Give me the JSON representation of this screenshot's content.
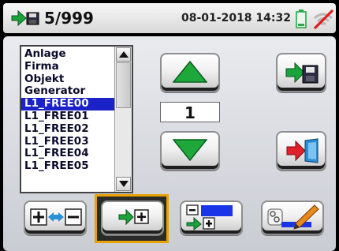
{
  "header": {
    "counter": "5/999",
    "datetime": "08-01-2018 14:32",
    "icons": {
      "record": "record-icon",
      "battery": "battery-icon",
      "wifi": "wifi-off-icon"
    }
  },
  "list": {
    "items": [
      "Anlage",
      "Firma",
      "Objekt",
      "Generator",
      "L1_FREE00",
      "L1_FREE01",
      "L1_FREE02",
      "L1_FREE03",
      "L1_FREE04",
      "L1_FREE05"
    ],
    "selected_index": 4
  },
  "value": "1",
  "buttons": {
    "up": "arrow-up-icon",
    "down": "arrow-down-icon",
    "save": "save-icon",
    "exit": "exit-icon"
  },
  "toolbar": {
    "items": [
      "add-remove-icon",
      "add-item-icon",
      "insert-field-icon",
      "edit-field-icon"
    ],
    "selected_index": 1
  },
  "colors": {
    "selection": "#1b22c8",
    "arrow_green": "#1ea83c",
    "toolbar_highlight": "#e7a100",
    "exit_red": "#e0202a",
    "door_blue": "#2a8fd6"
  }
}
